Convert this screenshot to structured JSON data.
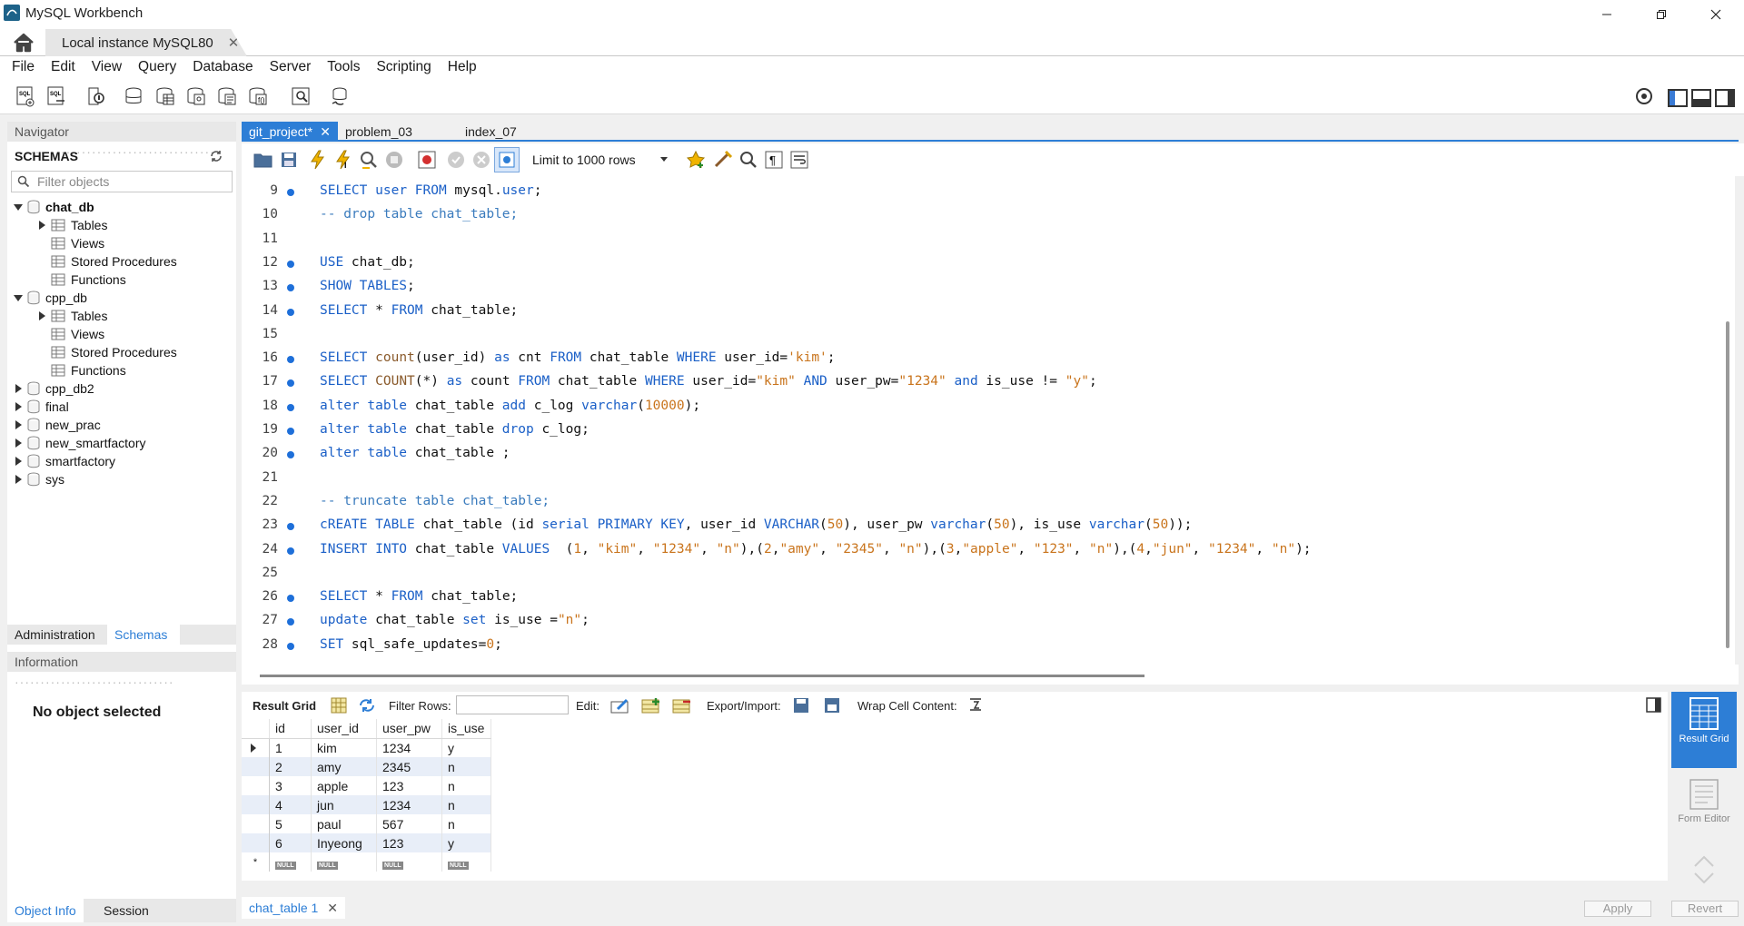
{
  "window": {
    "title": "MySQL Workbench"
  },
  "connection_tab": {
    "label": "Local instance MySQL80"
  },
  "menu": [
    "File",
    "Edit",
    "View",
    "Query",
    "Database",
    "Server",
    "Tools",
    "Scripting",
    "Help"
  ],
  "navigator": {
    "header": "Navigator",
    "schemas_label": "SCHEMAS",
    "filter_placeholder": "Filter objects",
    "tree": [
      {
        "label": "chat_db",
        "bold": true,
        "expanded": true,
        "children": [
          "Tables",
          "Views",
          "Stored Procedures",
          "Functions"
        ]
      },
      {
        "label": "cpp_db",
        "expanded": true,
        "children": [
          "Tables",
          "Views",
          "Stored Procedures",
          "Functions"
        ]
      },
      {
        "label": "cpp_db2"
      },
      {
        "label": "final"
      },
      {
        "label": "new_prac"
      },
      {
        "label": "new_smartfactory"
      },
      {
        "label": "smartfactory"
      },
      {
        "label": "sys"
      }
    ],
    "bottom_tabs": [
      "Administration",
      "Schemas"
    ],
    "info_header": "Information",
    "no_object": "No object selected",
    "footer_tabs": [
      "Object Info",
      "Session"
    ]
  },
  "editor_tabs": [
    {
      "label": "git_project*",
      "active": true
    },
    {
      "label": "problem_03"
    },
    {
      "label": "index_07"
    }
  ],
  "sql_toolbar": {
    "limit": "Limit to 1000 rows"
  },
  "code_lines": [
    {
      "n": "9",
      "dot": true,
      "html": "<span class='kw'>SELECT</span> <span class='kw'>user</span> <span class='kw'>FROM</span> mysql.<span class='kw'>user</span>;"
    },
    {
      "n": "10",
      "dot": false,
      "html": "<span class='cm'>-- drop table chat_table;</span>"
    },
    {
      "n": "11",
      "dot": false,
      "html": ""
    },
    {
      "n": "12",
      "dot": true,
      "html": "<span class='kw'>USE</span> chat_db;"
    },
    {
      "n": "13",
      "dot": true,
      "html": "<span class='kw'>SHOW TABLES</span>;"
    },
    {
      "n": "14",
      "dot": true,
      "html": "<span class='kw'>SELECT</span> * <span class='kw'>FROM</span> chat_table;"
    },
    {
      "n": "15",
      "dot": false,
      "html": ""
    },
    {
      "n": "16",
      "dot": true,
      "html": "<span class='kw'>SELECT</span> <span class='fn'>count</span>(user_id) <span class='kw'>as</span> cnt <span class='kw'>FROM</span> chat_table <span class='kw'>WHERE</span> user_id=<span class='st'>'kim'</span>;"
    },
    {
      "n": "17",
      "dot": true,
      "html": "<span class='kw'>SELECT</span> <span class='fn'>COUNT</span>(*) <span class='kw'>as</span> count <span class='kw'>FROM</span> chat_table <span class='kw'>WHERE</span> user_id=<span class='st'>\"kim\"</span> <span class='kw'>AND</span> user_pw=<span class='st'>\"1234\"</span> <span class='kw'>and</span> is_use != <span class='st'>\"y\"</span>;"
    },
    {
      "n": "18",
      "dot": true,
      "html": "<span class='kw'>alter table</span> chat_table <span class='kw'>add</span> c_log <span class='kw'>varchar</span>(<span class='num'>10000</span>);"
    },
    {
      "n": "19",
      "dot": true,
      "html": "<span class='kw'>alter table</span> chat_table <span class='kw'>drop</span> c_log;"
    },
    {
      "n": "20",
      "dot": true,
      "html": "<span class='kw'>alter table</span> chat_table ;"
    },
    {
      "n": "21",
      "dot": false,
      "html": ""
    },
    {
      "n": "22",
      "dot": false,
      "html": "<span class='cm'>-- truncate table chat_table;</span>"
    },
    {
      "n": "23",
      "dot": true,
      "html": "<span class='kw'>cREATE TABLE</span> chat_table (id <span class='kw'>serial</span> <span class='kw'>PRIMARY KEY</span>, user_id <span class='kw'>VARCHAR</span>(<span class='num'>50</span>), user_pw <span class='kw'>varchar</span>(<span class='num'>50</span>), is_use <span class='kw'>varchar</span>(<span class='num'>50</span>));"
    },
    {
      "n": "24",
      "dot": true,
      "html": "<span class='kw'>INSERT INTO</span> chat_table <span class='kw'>VALUES</span>  (<span class='num'>1</span>, <span class='st'>\"kim\"</span>, <span class='st'>\"1234\"</span>, <span class='st'>\"n\"</span>),(<span class='num'>2</span>,<span class='st'>\"amy\"</span>, <span class='st'>\"2345\"</span>, <span class='st'>\"n\"</span>),(<span class='num'>3</span>,<span class='st'>\"apple\"</span>, <span class='st'>\"123\"</span>, <span class='st'>\"n\"</span>),(<span class='num'>4</span>,<span class='st'>\"jun\"</span>, <span class='st'>\"1234\"</span>, <span class='st'>\"n\"</span>);"
    },
    {
      "n": "25",
      "dot": false,
      "html": ""
    },
    {
      "n": "26",
      "dot": true,
      "html": "<span class='kw'>SELECT</span> * <span class='kw'>FROM</span> chat_table;"
    },
    {
      "n": "27",
      "dot": true,
      "html": "<span class='kw'>update</span> chat_table <span class='kw'>set</span> is_use =<span class='st'>\"n\"</span>;"
    },
    {
      "n": "28",
      "dot": true,
      "html": "<span class='kw'>SET</span> sql_safe_updates=<span class='num'>0</span>;"
    }
  ],
  "result_toolbar": {
    "result_grid": "Result Grid",
    "filter_rows": "Filter Rows:",
    "edit": "Edit:",
    "export_import": "Export/Import:",
    "wrap": "Wrap Cell Content:"
  },
  "result": {
    "columns": [
      "id",
      "user_id",
      "user_pw",
      "is_use"
    ],
    "rows": [
      [
        "1",
        "kim",
        "1234",
        "y"
      ],
      [
        "2",
        "amy",
        "2345",
        "n"
      ],
      [
        "3",
        "apple",
        "123",
        "n"
      ],
      [
        "4",
        "jun",
        "1234",
        "n"
      ],
      [
        "5",
        "paul",
        "567",
        "n"
      ],
      [
        "6",
        "Inyeong",
        "123",
        "y"
      ]
    ],
    "null_label": "NULL"
  },
  "right_panel": {
    "result_grid": "Result Grid",
    "form_editor": "Form Editor"
  },
  "bottom": {
    "tab": "chat_table 1",
    "apply": "Apply",
    "revert": "Revert"
  }
}
